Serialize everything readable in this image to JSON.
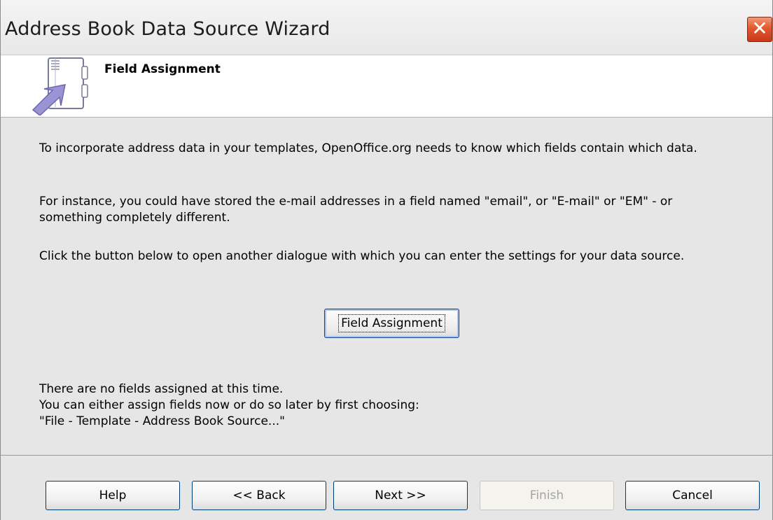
{
  "window": {
    "title": "Address Book Data Source Wizard",
    "close_glyph": "✕"
  },
  "header": {
    "step_title": "Field Assignment",
    "icon": "address-book-wizard-icon"
  },
  "content": {
    "paragraph_1": "To incorporate address data in your templates, OpenOffice.org needs to know which fields contain which data.",
    "paragraph_2": "For instance, you could have stored the e-mail addresses in a field named \"email\", or \"E-mail\" or \"EM\" - or something completely different.",
    "paragraph_3": "Click the button below to open another dialogue with which you can enter the settings for your data source.",
    "field_assignment_button": "Field Assignment",
    "status_line_1": "There are no fields assigned at this time.",
    "status_line_2": "You can either assign fields now or do so later by first choosing:",
    "status_line_3": "\"File - Template - Address Book Source...\""
  },
  "footer": {
    "help_label": "Help",
    "back_label": "<< Back",
    "next_label": "Next >>",
    "finish_label": "Finish",
    "cancel_label": "Cancel",
    "finish_enabled": false
  },
  "colors": {
    "dialog_background": "#e6e6e6",
    "header_background": "#ffffff",
    "close_button": "#e2582f",
    "button_border": "#003c74",
    "disabled_text": "#a4a4a4"
  }
}
